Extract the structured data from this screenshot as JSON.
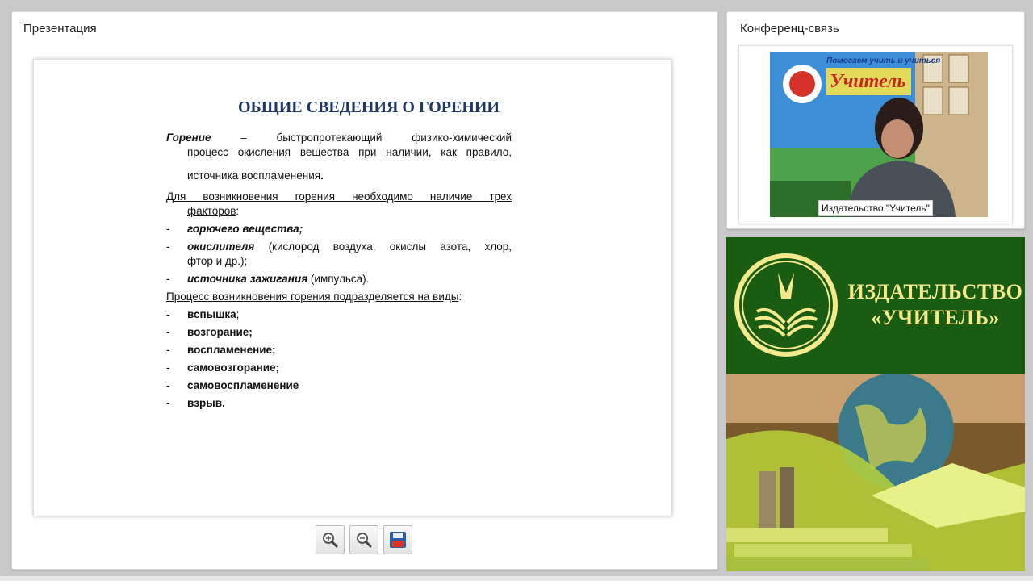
{
  "presentation": {
    "title": "Презентация",
    "slide": {
      "heading": "ОБЩИЕ СВЕДЕНИЯ О ГОРЕНИИ",
      "definition_term": "Горение",
      "definition_line1": "– быстропротекающий физико-химический",
      "definition_line2": "процесс окисления вещества при наличии, как правило,",
      "definition_line3": "источника воспламенения",
      "factors_intro": "Для возникновения горения необходимо наличие трех",
      "factors_intro2": "факторов",
      "factors": [
        {
          "bold": "горючего вещества;",
          "rest": ""
        },
        {
          "bold": "окислителя",
          "rest": " (кислород воздуха, окислы азота, хлор,"
        },
        {
          "bold": "источника зажигания",
          "rest": " (импульса)."
        }
      ],
      "factor2_cont": "фтор и др.);",
      "types_intro": "Процесс возникновения горения подразделяется на виды",
      "types": [
        "вспышка",
        "возгорание;",
        "воспламенение;",
        "самовозгорание;",
        "самовоспламенение",
        "взрыв."
      ],
      "dash": "-"
    },
    "toolbar": {
      "zoom_in_icon": "zoom-in-icon",
      "zoom_out_icon": "zoom-out-icon",
      "save_icon": "save-icon"
    }
  },
  "conference": {
    "title": "Конференц-связь",
    "video_label": "Издательство \"Учитель\"",
    "background_sign_line1": "Помогаем учить и учиться",
    "background_sign_brand": "Учитель"
  },
  "banner": {
    "publisher_line1": "ИЗДАТЕЛЬСТВО",
    "publisher_line2": "«УЧИТЕЛЬ»",
    "colors": {
      "green": "#1a5c12",
      "gold": "#f4ea8c"
    }
  }
}
